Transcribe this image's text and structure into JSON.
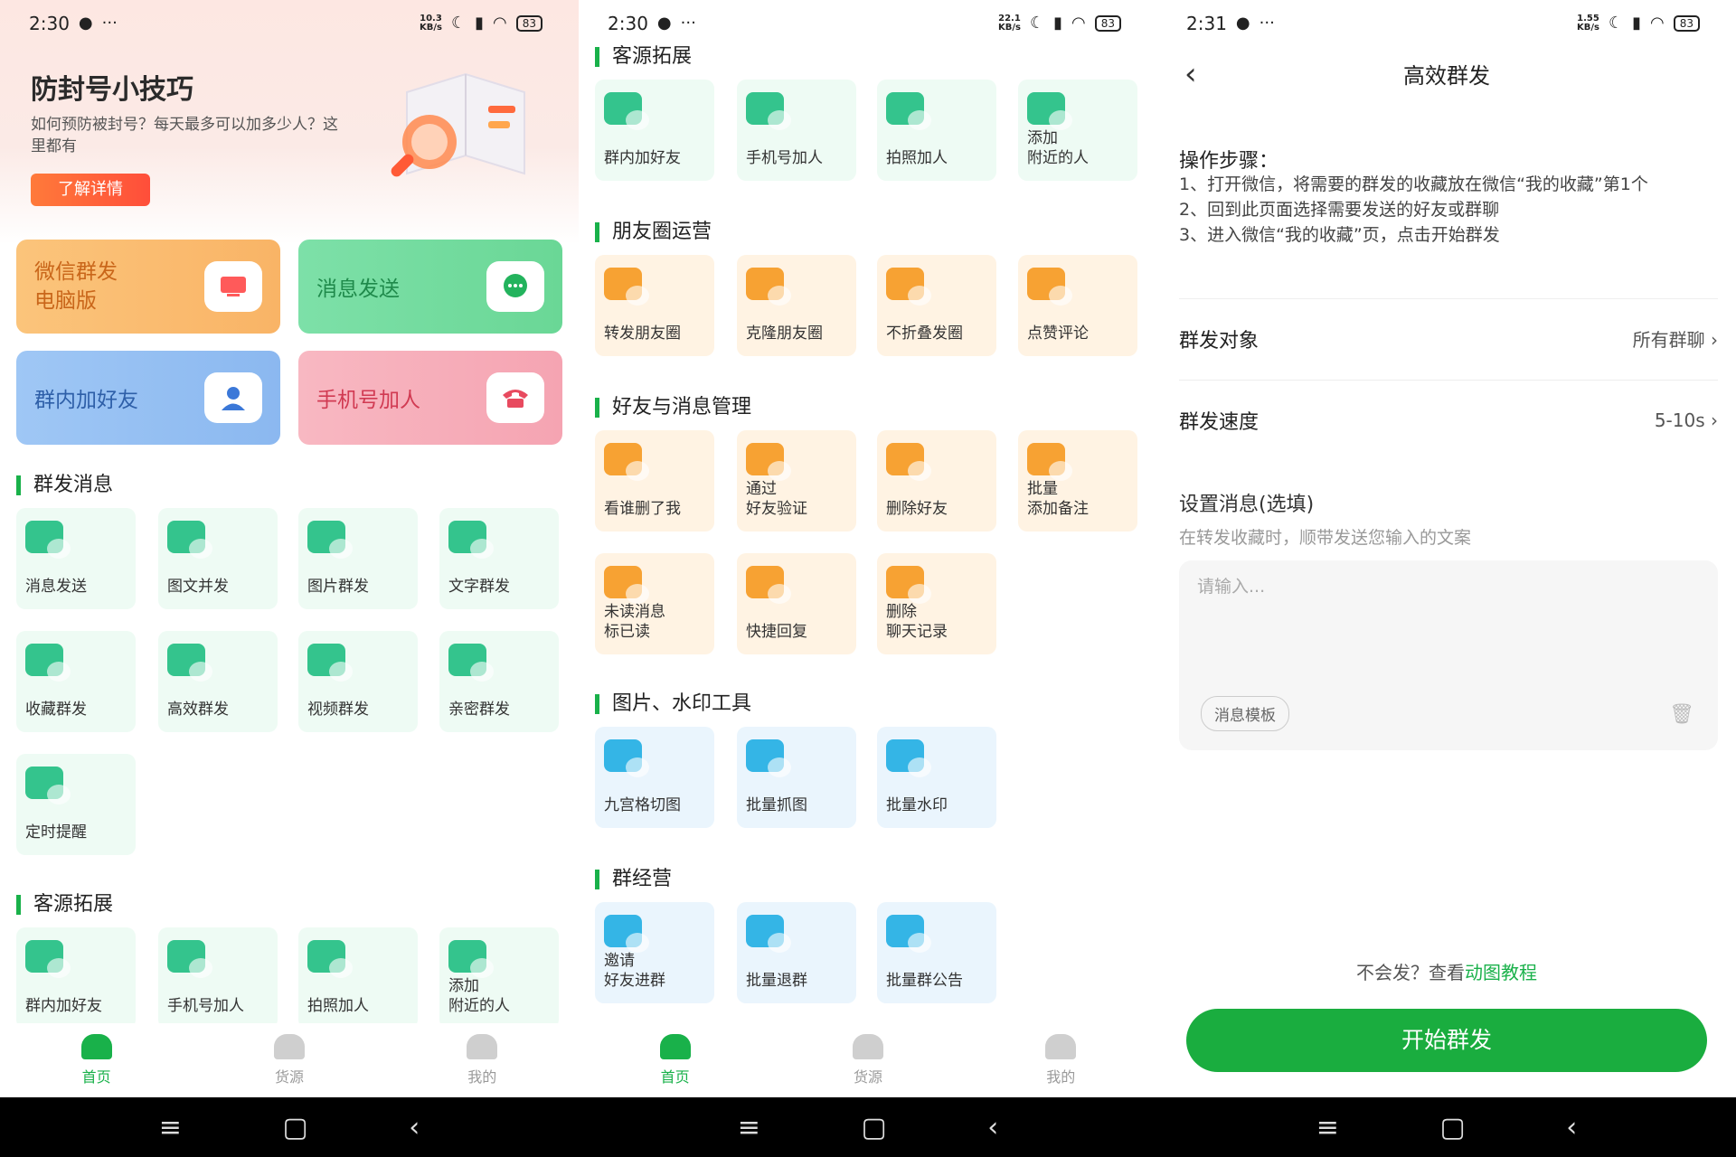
{
  "status": {
    "s1": {
      "time": "2:30",
      "speed": "10.3",
      "unit": "KB/s",
      "battery": "83"
    },
    "s2": {
      "time": "2:30",
      "speed": "22.1",
      "unit": "KB/s",
      "battery": "83"
    },
    "s3": {
      "time": "2:31",
      "speed": "1.55",
      "unit": "KB/s",
      "battery": "83"
    }
  },
  "home": {
    "banner": {
      "title": "防封号小技巧",
      "subtitle": "如何预防被封号？每天最多可以加多少人？这里都有",
      "button": "了解详情"
    },
    "features": [
      "微信群发\n电脑版",
      "消息发送",
      "群内加好友",
      "手机号加人"
    ],
    "sections": [
      {
        "title": "群发消息",
        "items": [
          "消息发送",
          "图文并发",
          "图片群发",
          "文字群发",
          "收藏群发",
          "高效群发",
          "视频群发",
          "亲密群发",
          "定时提醒"
        ]
      },
      {
        "title": "客源拓展",
        "items": [
          "群内加好友",
          "手机号加人",
          "拍照加人",
          "添加\n附近的人"
        ]
      }
    ]
  },
  "tools": {
    "sections": [
      {
        "title": "客源拓展",
        "items": [
          "群内加好友",
          "手机号加人",
          "拍照加人",
          "添加\n附近的人"
        ]
      },
      {
        "title": "朋友圈运营",
        "items": [
          "转发朋友圈",
          "克隆朋友圈",
          "不折叠发圈",
          "点赞评论"
        ]
      },
      {
        "title": "好友与消息管理",
        "items": [
          "看谁删了我",
          "通过\n好友验证",
          "删除好友",
          "批量\n添加备注",
          "未读消息\n标已读",
          "快捷回复",
          "删除\n聊天记录"
        ]
      },
      {
        "title": "图片、水印工具",
        "items": [
          "九宫格切图",
          "批量抓图",
          "批量水印"
        ]
      },
      {
        "title": "群经营",
        "items": [
          "邀请\n好友进群",
          "批量退群",
          "批量群公告"
        ]
      }
    ]
  },
  "tabbar": [
    "首页",
    "货源",
    "我的"
  ],
  "detail": {
    "title": "高效群发",
    "steps_title": "操作步骤：",
    "steps": [
      "1、打开微信，将需要的群发的收藏放在微信“我的收藏”第1个",
      "2、回到此页面选择需要发送的好友或群聊",
      "3、进入微信“我的收藏”页，点击开始群发"
    ],
    "target_label": "群发对象",
    "target_value": "所有群聊",
    "speed_label": "群发速度",
    "speed_value": "5-10s",
    "msg_title": "设置消息(选填)",
    "msg_sub": "在转发收藏时，顺带发送您输入的文案",
    "msg_placeholder": "请输入...",
    "template_btn": "消息模板",
    "help_prefix": "不会发？查看",
    "help_link": "动图教程",
    "start_btn": "开始群发"
  },
  "colors": {
    "accent": "#1aad3f"
  }
}
